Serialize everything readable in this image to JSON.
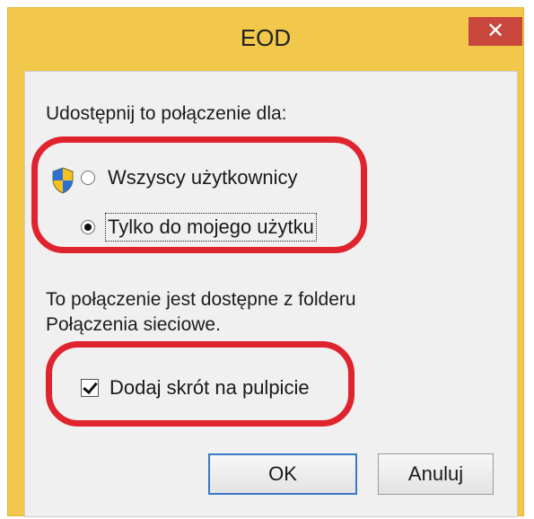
{
  "window": {
    "title": "EOD",
    "close_label": "✕"
  },
  "dialog": {
    "share_prompt": "Udostępnij to połączenie dla:",
    "options": [
      {
        "label": "Wszyscy użytkownicy",
        "selected": false,
        "shield": true
      },
      {
        "label": "Tylko do mojego użytku",
        "selected": true,
        "shield": false
      }
    ],
    "info_line1": "To połączenie jest dostępne z folderu",
    "info_line2": "Połączenia sieciowe.",
    "checkbox": {
      "label": "Dodaj skrót na pulpicie",
      "checked": true
    }
  },
  "buttons": {
    "ok": "OK",
    "cancel": "Anuluj"
  },
  "colors": {
    "title_bar": "#f2c84b",
    "close": "#c9463d",
    "highlight": "#e0242e"
  }
}
